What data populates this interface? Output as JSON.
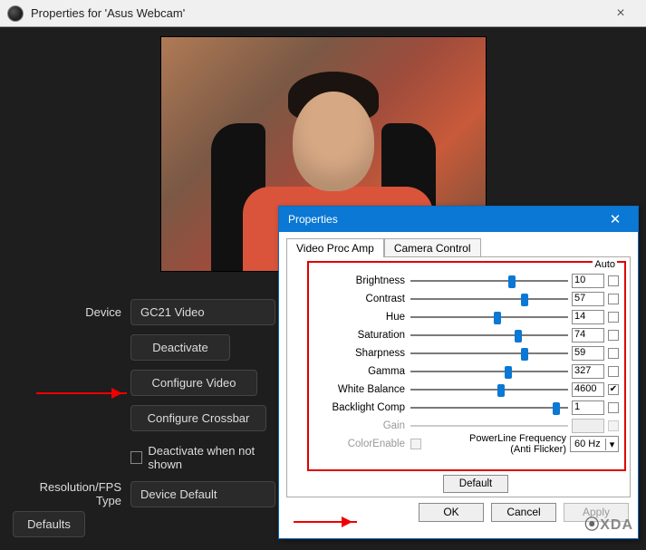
{
  "obs": {
    "title": "Properties for 'Asus Webcam'",
    "labels": {
      "device": "Device",
      "res_fps": "Resolution/FPS Type"
    },
    "device_value": "GC21 Video",
    "buttons": {
      "deactivate": "Deactivate",
      "configure_video": "Configure Video",
      "configure_crossbar": "Configure Crossbar",
      "defaults": "Defaults"
    },
    "deactivate_when": "Deactivate when not shown",
    "res_fps_value": "Device Default"
  },
  "win": {
    "title": "Properties",
    "tabs": {
      "amp": "Video Proc Amp",
      "cam": "Camera Control"
    },
    "auto_header": "Auto",
    "sliders": [
      {
        "label": "Brightness",
        "value": "10",
        "pos": 0.62,
        "auto": false,
        "enabled": true
      },
      {
        "label": "Contrast",
        "value": "57",
        "pos": 0.7,
        "auto": false,
        "enabled": true
      },
      {
        "label": "Hue",
        "value": "14",
        "pos": 0.53,
        "auto": false,
        "enabled": true
      },
      {
        "label": "Saturation",
        "value": "74",
        "pos": 0.66,
        "auto": false,
        "enabled": true
      },
      {
        "label": "Sharpness",
        "value": "59",
        "pos": 0.7,
        "auto": false,
        "enabled": true
      },
      {
        "label": "Gamma",
        "value": "327",
        "pos": 0.6,
        "auto": false,
        "enabled": true
      },
      {
        "label": "White Balance",
        "value": "4600",
        "pos": 0.55,
        "auto": true,
        "enabled": true
      },
      {
        "label": "Backlight Comp",
        "value": "1",
        "pos": 0.9,
        "auto": false,
        "enabled": true
      },
      {
        "label": "Gain",
        "value": "",
        "pos": 0.0,
        "auto": false,
        "enabled": false
      }
    ],
    "colorenable": "ColorEnable",
    "plf_label1": "PowerLine Frequency",
    "plf_label2": "(Anti Flicker)",
    "plf_value": "60 Hz",
    "default_btn": "Default",
    "ok": "OK",
    "cancel": "Cancel",
    "apply": "Apply"
  },
  "watermark": "XDA"
}
